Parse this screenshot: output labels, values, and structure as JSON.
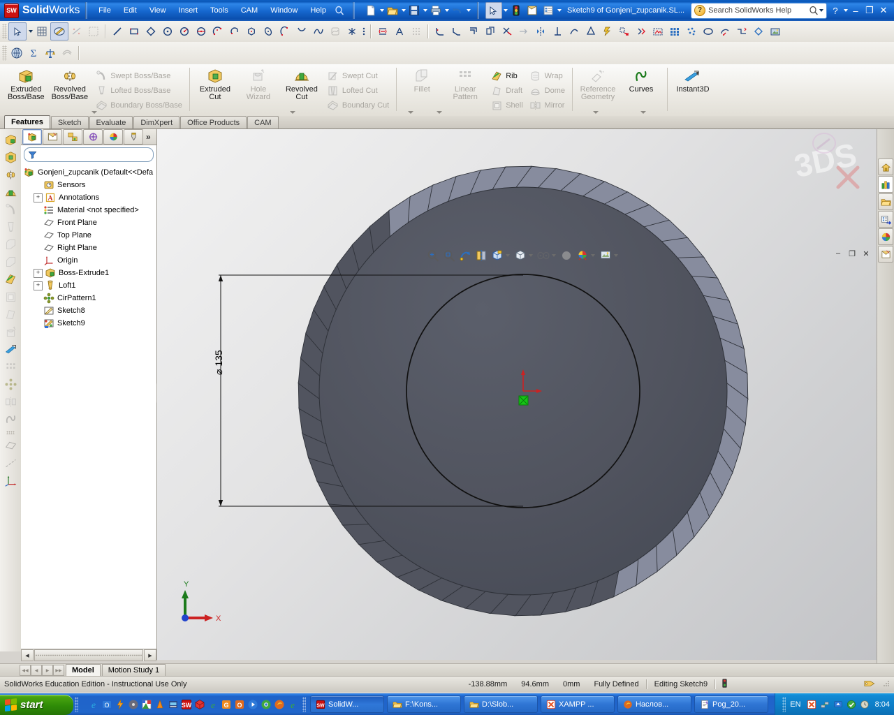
{
  "titlebar": {
    "brand_bold": "Solid",
    "brand_light": "Works",
    "menus": [
      "File",
      "Edit",
      "View",
      "Insert",
      "Tools",
      "CAM",
      "Window",
      "Help"
    ],
    "document_title": "Sketch9 of Gonjeni_zupcanik.SL...",
    "search_placeholder": "Search SolidWorks Help",
    "minimize": "–",
    "maximize": "❐",
    "close": "✕",
    "help": "?"
  },
  "ribbon": {
    "groups": [
      {
        "big": [
          {
            "label1": "Extruded",
            "label2": "Boss/Base",
            "icon": "extruded-boss-icon",
            "enabled": true
          },
          {
            "label1": "Revolved",
            "label2": "Boss/Base",
            "icon": "revolved-boss-icon",
            "enabled": true
          }
        ],
        "small": [
          {
            "label": "Swept Boss/Base",
            "icon": "swept-boss-icon",
            "enabled": false
          },
          {
            "label": "Lofted Boss/Base",
            "icon": "lofted-boss-icon",
            "enabled": false
          },
          {
            "label": "Boundary Boss/Base",
            "icon": "boundary-boss-icon",
            "enabled": false
          }
        ]
      },
      {
        "big": [
          {
            "label1": "Extruded",
            "label2": "Cut",
            "icon": "extruded-cut-icon",
            "enabled": true
          },
          {
            "label1": "Hole",
            "label2": "Wizard",
            "icon": "hole-wizard-icon",
            "enabled": false
          },
          {
            "label1": "Revolved",
            "label2": "Cut",
            "icon": "revolved-cut-icon",
            "enabled": true
          }
        ],
        "small": [
          {
            "label": "Swept Cut",
            "icon": "swept-cut-icon",
            "enabled": false
          },
          {
            "label": "Lofted Cut",
            "icon": "lofted-cut-icon",
            "enabled": false
          },
          {
            "label": "Boundary Cut",
            "icon": "boundary-cut-icon",
            "enabled": false
          }
        ]
      },
      {
        "big": [
          {
            "label1": "Fillet",
            "label2": "",
            "icon": "fillet-icon",
            "enabled": false
          },
          {
            "label1": "Linear",
            "label2": "Pattern",
            "icon": "linear-pattern-icon",
            "enabled": false
          }
        ],
        "small": [
          {
            "label": "Rib",
            "icon": "rib-icon",
            "enabled": true
          },
          {
            "label": "Draft",
            "icon": "draft-icon",
            "enabled": false
          },
          {
            "label": "Shell",
            "icon": "shell-icon",
            "enabled": false
          }
        ],
        "small2": [
          {
            "label": "Wrap",
            "icon": "wrap-icon",
            "enabled": false
          },
          {
            "label": "Dome",
            "icon": "dome-icon",
            "enabled": false
          },
          {
            "label": "Mirror",
            "icon": "mirror-icon",
            "enabled": false
          }
        ]
      },
      {
        "big": [
          {
            "label1": "Reference",
            "label2": "Geometry",
            "icon": "reference-geometry-icon",
            "enabled": false
          },
          {
            "label1": "Curves",
            "label2": "",
            "icon": "curves-icon",
            "enabled": true
          }
        ]
      },
      {
        "big": [
          {
            "label1": "Instant3D",
            "label2": "",
            "icon": "instant3d-icon",
            "enabled": true
          }
        ]
      }
    ]
  },
  "command_tabs": [
    {
      "label": "Features",
      "active": true
    },
    {
      "label": "Sketch",
      "active": false
    },
    {
      "label": "Evaluate",
      "active": false
    },
    {
      "label": "DimXpert",
      "active": false
    },
    {
      "label": "Office Products",
      "active": false
    },
    {
      "label": "CAM",
      "active": false
    }
  ],
  "feature_manager": {
    "tabs": [
      {
        "name": "feature-manager-tab",
        "active": true
      },
      {
        "name": "property-manager-tab",
        "active": false
      },
      {
        "name": "configuration-manager-tab",
        "active": false
      },
      {
        "name": "dimxpert-manager-tab",
        "active": false
      },
      {
        "name": "display-manager-tab",
        "active": false
      },
      {
        "name": "cam-manager-tab",
        "active": false
      }
    ],
    "more_label": "»",
    "filter_placeholder": "",
    "tree": [
      {
        "label": "Gonjeni_zupcanik  (Default<<Defa",
        "icon": "part-icon",
        "expandable": false,
        "indent": 0
      },
      {
        "label": "Sensors",
        "icon": "sensors-icon",
        "expandable": false,
        "indent": 1
      },
      {
        "label": "Annotations",
        "icon": "annotations-icon",
        "expandable": true,
        "indent": 1
      },
      {
        "label": "Material <not specified>",
        "icon": "material-icon",
        "expandable": false,
        "indent": 1
      },
      {
        "label": "Front Plane",
        "icon": "plane-icon",
        "expandable": false,
        "indent": 1
      },
      {
        "label": "Top Plane",
        "icon": "plane-icon",
        "expandable": false,
        "indent": 1
      },
      {
        "label": "Right Plane",
        "icon": "plane-icon",
        "expandable": false,
        "indent": 1
      },
      {
        "label": "Origin",
        "icon": "origin-icon",
        "expandable": false,
        "indent": 1
      },
      {
        "label": "Boss-Extrude1",
        "icon": "boss-extrude-icon",
        "expandable": true,
        "indent": 1
      },
      {
        "label": "Loft1",
        "icon": "loft-icon",
        "expandable": true,
        "indent": 1
      },
      {
        "label": "CirPattern1",
        "icon": "cirpattern-icon",
        "expandable": false,
        "indent": 1
      },
      {
        "label": "Sketch8",
        "icon": "sketch-icon",
        "expandable": false,
        "indent": 1
      },
      {
        "label": "Sketch9",
        "icon": "sketch-active-icon",
        "expandable": false,
        "indent": 1
      }
    ]
  },
  "graphics": {
    "dimension_label": "⌀ 135",
    "triad_x": "X",
    "triad_y": "Y",
    "view_tools": [
      "zoom-to-fit-icon",
      "zoom-to-area-icon",
      "previous-view-icon",
      "section-view-icon",
      "view-orientation-icon",
      "display-style-icon",
      "hide-show-icon",
      "edit-appearance-icon",
      "apply-scene-icon",
      "view-settings-icon"
    ],
    "task_pane": [
      {
        "name": "solidworks-resources-icon",
        "active": false
      },
      {
        "name": "design-library-icon",
        "active": true
      },
      {
        "name": "file-explorer-icon",
        "active": false
      },
      {
        "name": "search-icon",
        "active": false
      },
      {
        "name": "appearances-scenes-icon",
        "active": false
      },
      {
        "name": "custom-properties-icon",
        "active": false
      }
    ]
  },
  "bottom_tabs": [
    {
      "label": "Model",
      "active": true
    },
    {
      "label": "Motion Study 1",
      "active": false
    }
  ],
  "status_bar": {
    "message": "SolidWorks Education Edition - Instructional Use Only",
    "x_coord": "-138.88mm",
    "y_coord": "94.6mm",
    "z_coord": "0mm",
    "state": "Fully Defined",
    "editing": "Editing Sketch9"
  },
  "taskbar": {
    "start_label": "start",
    "quick_launch": [
      "internet-explorer-icon",
      "outlook-icon",
      "flash-icon",
      "media-icon",
      "paint-icon",
      "vlc-icon",
      "winamp-icon",
      "solidworks-icon",
      "cam-icon",
      "edge-icon",
      "opera-icon",
      "office-icon",
      "player-icon",
      "chrome-icon",
      "firefox-icon",
      "edge2-icon"
    ],
    "windows": [
      {
        "label": "SolidW...",
        "icon": "solidworks-icon",
        "active": true
      },
      {
        "label": "F:\\Kons...",
        "icon": "folder-icon",
        "active": false
      },
      {
        "label": "D:\\Slob...",
        "icon": "folder-icon",
        "active": false
      },
      {
        "label": "XAMPP ...",
        "icon": "xampp-icon",
        "active": false
      },
      {
        "label": "Наслов...",
        "icon": "firefox-icon",
        "active": false
      },
      {
        "label": "Pog_20...",
        "icon": "document-icon",
        "active": false
      }
    ],
    "language": "EN",
    "tray": [
      "xampp-tray-icon",
      "network-tray-icon",
      "update-tray-icon",
      "shield-tray-icon",
      "clock-tray-icon"
    ],
    "clock": "8:04"
  },
  "colors": {
    "accent": "#2166cb",
    "gear_body": "#51545f",
    "gear_tooth": "#878c9e",
    "taskbar_green": "#2f8c07"
  }
}
